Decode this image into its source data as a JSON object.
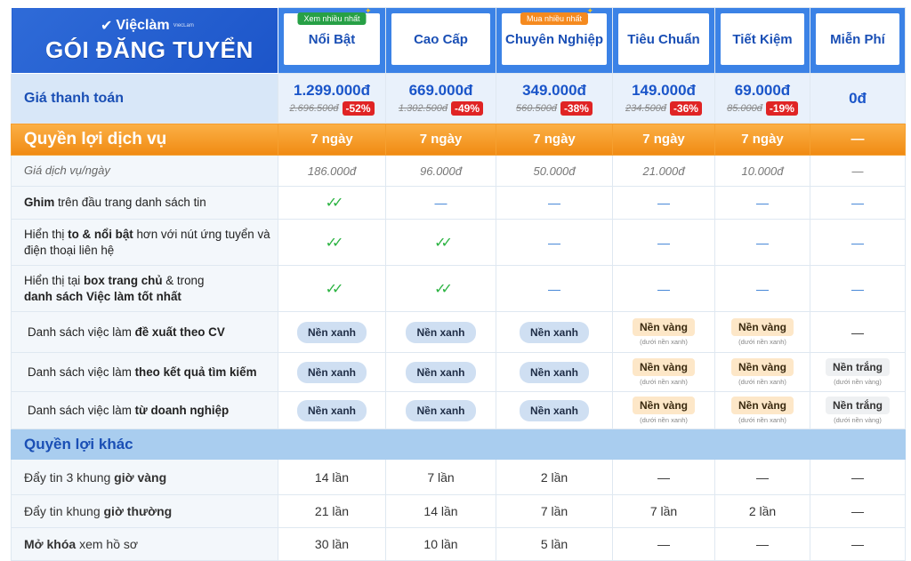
{
  "brand": {
    "logo": "Việclàm",
    "logo_sub": "ViecLam",
    "title": "GÓI ĐĂNG TUYỂN"
  },
  "plans": [
    {
      "name": "Nổi Bật",
      "tag": "Xem nhiều nhất",
      "tag_color": "green",
      "price": "1.299.000đ",
      "old": "2.696.500đ",
      "disc": "-52%",
      "days": "7 ngày",
      "per_day": "186.000đ"
    },
    {
      "name": "Cao Cấp",
      "tag": "",
      "price": "669.000đ",
      "old": "1.302.500đ",
      "disc": "-49%",
      "days": "7 ngày",
      "per_day": "96.000đ"
    },
    {
      "name": "Chuyên Nghiệp",
      "tag": "Mua nhiều nhất",
      "tag_color": "orange",
      "price": "349.000đ",
      "old": "560.500đ",
      "disc": "-38%",
      "days": "7 ngày",
      "per_day": "50.000đ"
    },
    {
      "name": "Tiêu Chuẩn",
      "tag": "",
      "price": "149.000đ",
      "old": "234.500đ",
      "disc": "-36%",
      "days": "7 ngày",
      "per_day": "21.000đ"
    },
    {
      "name": "Tiết Kiệm",
      "tag": "",
      "price": "69.000đ",
      "old": "85.000đ",
      "disc": "-19%",
      "days": "7 ngày",
      "per_day": "10.000đ"
    },
    {
      "name": "Miễn Phí",
      "tag": "",
      "price": "0đ",
      "old": "",
      "disc": "",
      "days": "—",
      "per_day": "—"
    }
  ],
  "labels": {
    "price": "Giá thanh toán",
    "services": "Quyền lợi dịch vụ",
    "per_day": "Giá dịch vụ/ngày",
    "pin_b": "Ghim",
    "pin_rest": " trên đầu trang danh sách tin",
    "big_1": "Hiển thị ",
    "big_b": "to & nổi bật",
    "big_2": " hơn với nút ứng tuyển và điện thoại liên hệ",
    "home_1": "Hiển thị tại ",
    "home_b1": "box trang chủ",
    "home_2": " & trong ",
    "home_b2": "danh sách Việc làm tốt nhất",
    "cv_1": "Danh sách việc làm ",
    "cv_b": "đề xuất theo CV",
    "search_1": "Danh sách việc làm ",
    "search_b": "theo kết quả tìm kiếm",
    "biz_1": "Danh sách việc làm ",
    "biz_b": "từ doanh nghiệp",
    "other": "Quyền lợi khác",
    "gold_1": "Đẩy tin 3 khung ",
    "gold_b": "giờ vàng",
    "normal_1": "Đẩy tin khung ",
    "normal_b": "giờ thường",
    "unlock_b": "Mở khóa",
    "unlock_2": " xem hồ sơ"
  },
  "pills": {
    "blue": "Nền xanh",
    "yellow": "Nền vàng",
    "yellow_sub": "(dưới nền xanh)",
    "white": "Nền trắng",
    "white_sub": "(dưới nền vàng)"
  },
  "rows": {
    "gold": [
      "14 lần",
      "7 lần",
      "2 lần",
      "—",
      "—",
      "—"
    ],
    "normal": [
      "21 lần",
      "14 lần",
      "7 lần",
      "7 lần",
      "2 lần",
      "—"
    ],
    "unlock": [
      "30 lần",
      "10 lần",
      "5 lần",
      "—",
      "—",
      "—"
    ]
  },
  "dash": "—",
  "colors": {
    "primary": "#1a55c9",
    "accent": "#f08a12",
    "discount": "#e02424",
    "check": "#2bb341"
  }
}
